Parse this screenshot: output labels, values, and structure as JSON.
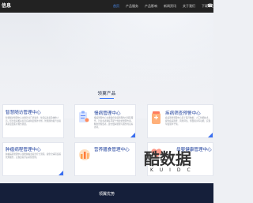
{
  "header": {
    "logo_text": "信息",
    "nav": [
      "首页",
      "产品服务",
      "产品影响",
      "新闻资讯",
      "关于我们",
      "下载中心"
    ],
    "active_index": 0
  },
  "section": {
    "title": "领翼产品"
  },
  "cards": [
    {
      "title": "智慧随访管理中心",
      "text": "智慧随访管理中心主要针对门诊复诊、住院后患者及体检人员，结合患者相关信息自动制定随访计划，智慧随访提升患者满意度及医疗服务质量。"
    },
    {
      "title": "慢病管理中心",
      "text": "慢病管理中心主要提供专病管理的全流程服务，针对患者特征匹配个性化的管理方案，精准管理患者，建立慢病管理与服务的良好闭环。"
    },
    {
      "title": "疾病筛查预警中心",
      "text": "疾病筛查预警中心基于医疗数据、人工智能技术，提供疾病筛查、风险评估、预警提示等功能，实现早发现早干预。"
    },
    {
      "title": "肿瘤病程管理中心",
      "text": "肿瘤病程管理中心围绕肿瘤患者诊疗全流程，提供全病程追踪管理服务，实现患者诊后持续管理。"
    },
    {
      "title": "营养膳食管理中心",
      "text": ""
    },
    {
      "title": "母婴健康管理中心",
      "text": ""
    }
  ],
  "band": {
    "title": "领翼优势"
  },
  "watermark": {
    "main": "酷数据",
    "sub": "KUIDC"
  },
  "colors": {
    "accent": "#3a6ff0",
    "card_title": "#1d3f9c",
    "dark": "#151f3a",
    "topbar": "#222222"
  },
  "icons": [
    "phone-icon",
    "clipboard-icon",
    "medicine-icon",
    "bar-chart-icon",
    "heart-hands-icon"
  ]
}
